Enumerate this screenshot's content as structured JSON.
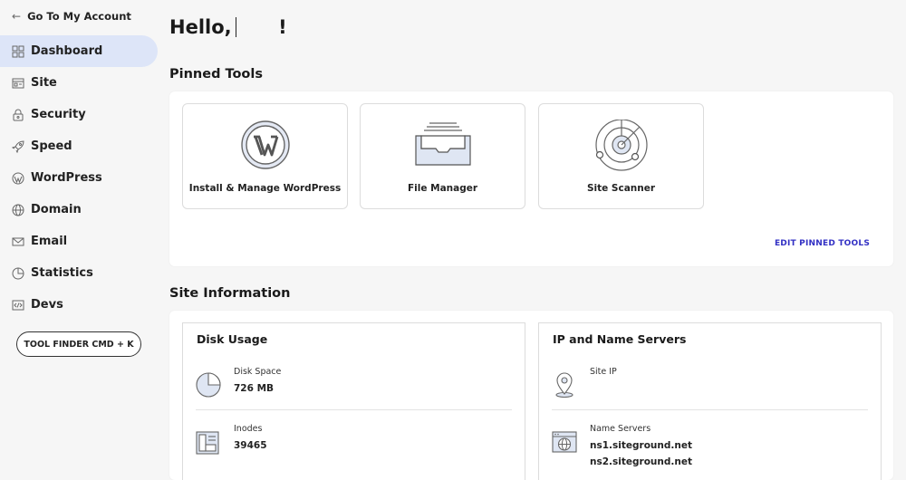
{
  "sidebar": {
    "back_label": "Go To My Account",
    "items": [
      {
        "label": "Dashboard",
        "icon": "dashboard-icon",
        "active": true
      },
      {
        "label": "Site",
        "icon": "site-icon"
      },
      {
        "label": "Security",
        "icon": "lock-icon"
      },
      {
        "label": "Speed",
        "icon": "rocket-icon"
      },
      {
        "label": "WordPress",
        "icon": "wordpress-icon"
      },
      {
        "label": "Domain",
        "icon": "globe-icon"
      },
      {
        "label": "Email",
        "icon": "envelope-icon"
      },
      {
        "label": "Statistics",
        "icon": "pie-chart-icon"
      },
      {
        "label": "Devs",
        "icon": "code-icon"
      }
    ],
    "tool_finder_label": "TOOL FINDER CMD + K"
  },
  "header": {
    "greeting": "Hello,",
    "greeting_end": "!"
  },
  "pinned_tools": {
    "title": "Pinned Tools",
    "tools": [
      {
        "label": "Install & Manage WordPress",
        "icon": "wordpress-logo-icon"
      },
      {
        "label": "File Manager",
        "icon": "file-tray-icon"
      },
      {
        "label": "Site Scanner",
        "icon": "radar-icon"
      }
    ],
    "edit_label": "EDIT PINNED TOOLS"
  },
  "site_information": {
    "title": "Site Information",
    "disk_usage": {
      "title": "Disk Usage",
      "disk_space_label": "Disk Space",
      "disk_space_value": "726 MB",
      "inodes_label": "Inodes",
      "inodes_value": "39465"
    },
    "ip_name_servers": {
      "title": "IP and Name Servers",
      "site_ip_label": "Site IP",
      "name_servers_label": "Name Servers",
      "name_servers": [
        "ns1.siteground.net",
        "ns2.siteground.net"
      ]
    }
  },
  "colors": {
    "accent": "#3230c4",
    "active_nav_bg": "#dde5f8",
    "background": "#f6f6f6"
  }
}
